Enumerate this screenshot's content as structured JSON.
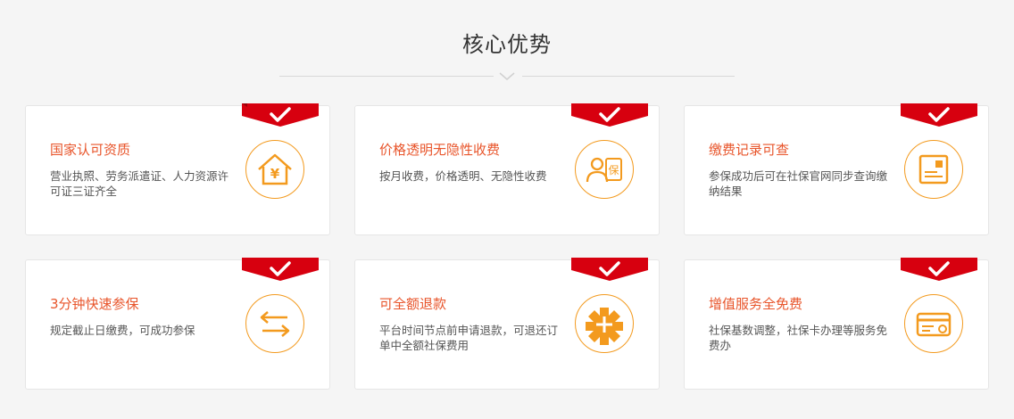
{
  "section": {
    "title": "核心优势"
  },
  "cards": [
    {
      "title": "国家认可资质",
      "desc": "营业执照、劳务派遣证、人力资源许可证三证齐全",
      "icon": "house-yuan-icon"
    },
    {
      "title": "价格透明无隐性收费",
      "desc": "按月收费，价格透明、无隐性收费",
      "icon": "person-bao-icon"
    },
    {
      "title": "缴费记录可查",
      "desc": "参保成功后可在社保官网同步查询缴纳结果",
      "icon": "record-card-icon"
    },
    {
      "title": "3分钟快速参保",
      "desc": "规定截止日缴费，可成功参保",
      "icon": "exchange-arrows-icon"
    },
    {
      "title": "可全额退款",
      "desc": "平台时间节点前申请退款，可退还订单中全额社保费用",
      "icon": "refund-cross-icon"
    },
    {
      "title": "增值服务全免费",
      "desc": "社保基数调整，社保卡办理等服务免费办",
      "icon": "social-card-icon"
    }
  ],
  "colors": {
    "accent": "#e8552b",
    "icon": "#f39a1e",
    "ribbon": "#d7000f"
  }
}
